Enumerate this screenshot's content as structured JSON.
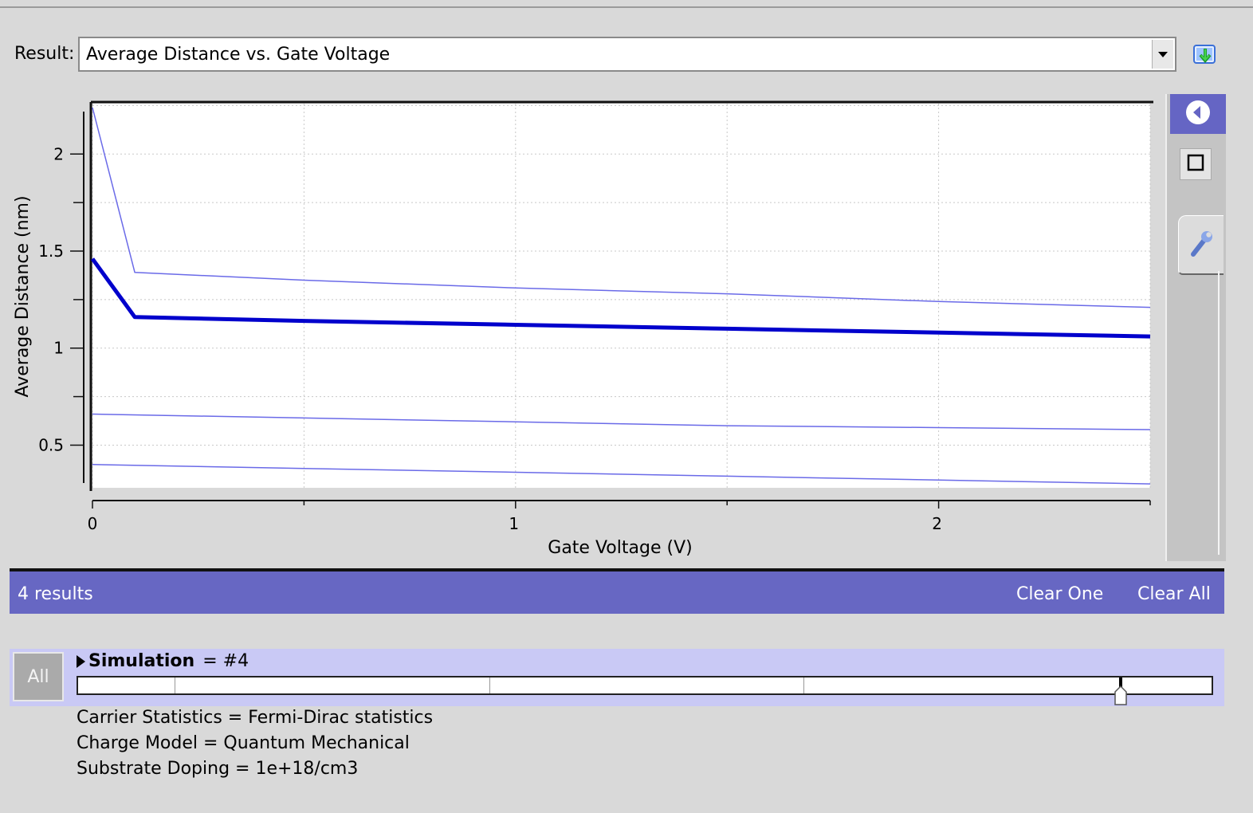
{
  "result": {
    "label": "Result:",
    "selected": "Average Distance vs. Gate Voltage"
  },
  "chart_data": {
    "type": "line",
    "xlabel": "Gate Voltage (V)",
    "ylabel": "Average Distance (nm)",
    "xlim": [
      0,
      2.5
    ],
    "ylim": [
      0.28,
      2.26
    ],
    "x_ticks": [
      0,
      1,
      2
    ],
    "y_ticks": [
      0.5,
      1,
      1.5,
      2
    ],
    "grid": true,
    "series": [
      {
        "color": "#6a6ae8",
        "width": 1.5,
        "points": [
          [
            0,
            2.24
          ],
          [
            0.1,
            1.39
          ],
          [
            0.5,
            1.35
          ],
          [
            1,
            1.31
          ],
          [
            1.5,
            1.28
          ],
          [
            2,
            1.24
          ],
          [
            2.5,
            1.21
          ]
        ]
      },
      {
        "color": "#0000cc",
        "width": 5,
        "points": [
          [
            0,
            1.46
          ],
          [
            0.1,
            1.16
          ],
          [
            0.5,
            1.14
          ],
          [
            1,
            1.12
          ],
          [
            1.5,
            1.1
          ],
          [
            2,
            1.08
          ],
          [
            2.5,
            1.06
          ]
        ]
      },
      {
        "color": "#6a6ae8",
        "width": 1.5,
        "points": [
          [
            0,
            0.66
          ],
          [
            0.5,
            0.64
          ],
          [
            1,
            0.62
          ],
          [
            1.5,
            0.6
          ],
          [
            2,
            0.59
          ],
          [
            2.5,
            0.58
          ]
        ]
      },
      {
        "color": "#6a6ae8",
        "width": 1.5,
        "points": [
          [
            0,
            0.4
          ],
          [
            0.5,
            0.38
          ],
          [
            1,
            0.36
          ],
          [
            1.5,
            0.34
          ],
          [
            2,
            0.32
          ],
          [
            2.5,
            0.3
          ]
        ]
      }
    ]
  },
  "results_bar": {
    "count": "4 results",
    "clear_one": "Clear One",
    "clear_all": "Clear All"
  },
  "simulation": {
    "all_label": "All",
    "name": "Simulation",
    "value": "= #4",
    "slider_position": 0.92,
    "slider_ticks": [
      0.085,
      0.363,
      0.64
    ]
  },
  "parameters": [
    "Carrier Statistics = Fermi-Dirac statistics",
    "Charge Model = Quantum Mechanical",
    "Substrate Doping = 1e+18/cm3"
  ],
  "icons": {
    "download": "download-icon",
    "back": "back-arrow-icon",
    "square": "square-icon",
    "wrench": "wrench-icon"
  },
  "colors": {
    "accent": "#6767c3",
    "panel_highlight": "#c9c9f5",
    "background": "#d9d9d9"
  }
}
